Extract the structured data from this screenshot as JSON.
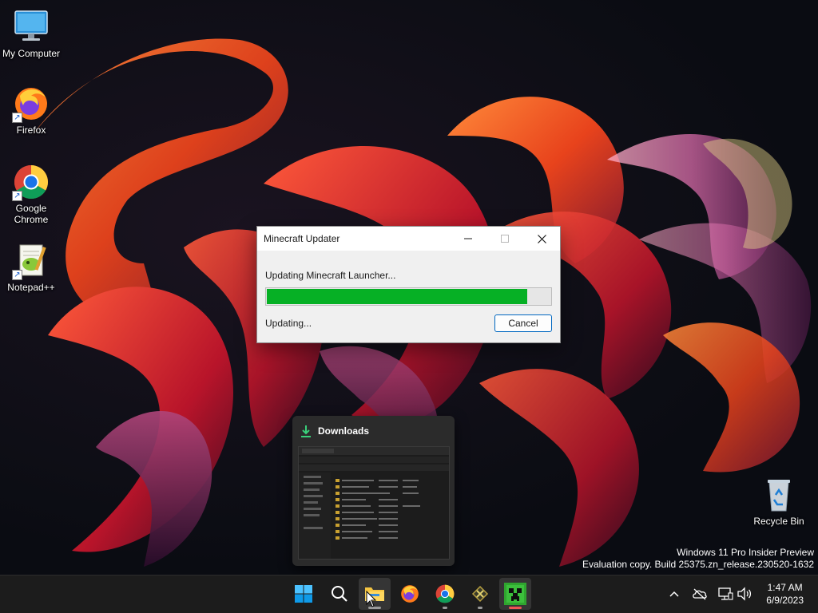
{
  "desktop": {
    "icons": [
      {
        "label": "My Computer"
      },
      {
        "label": "Firefox"
      },
      {
        "label": "Google Chrome"
      },
      {
        "label": "Notepad++"
      },
      {
        "label": "Recycle Bin"
      }
    ],
    "watermark": {
      "line1": "Windows 11 Pro Insider Preview",
      "line2": "Evaluation copy. Build 25375.zn_release.230520-1632"
    }
  },
  "dialog": {
    "title": "Minecraft Updater",
    "minimize_icon": "minimize-icon",
    "maximize_icon": "maximize-icon",
    "close_icon": "close-icon",
    "status_top": "Updating Minecraft Launcher...",
    "progress_percent": 92,
    "status_bottom": "Updating...",
    "cancel_label": "Cancel",
    "progress_color": "#06b025"
  },
  "downloads_thumbnail": {
    "title": "Downloads"
  },
  "taskbar": {
    "apps": [
      "start",
      "search",
      "file-explorer",
      "firefox",
      "chrome",
      "misc-app",
      "minecraft"
    ],
    "clock": {
      "time": "1:47 AM",
      "date": "6/9/2023"
    }
  }
}
